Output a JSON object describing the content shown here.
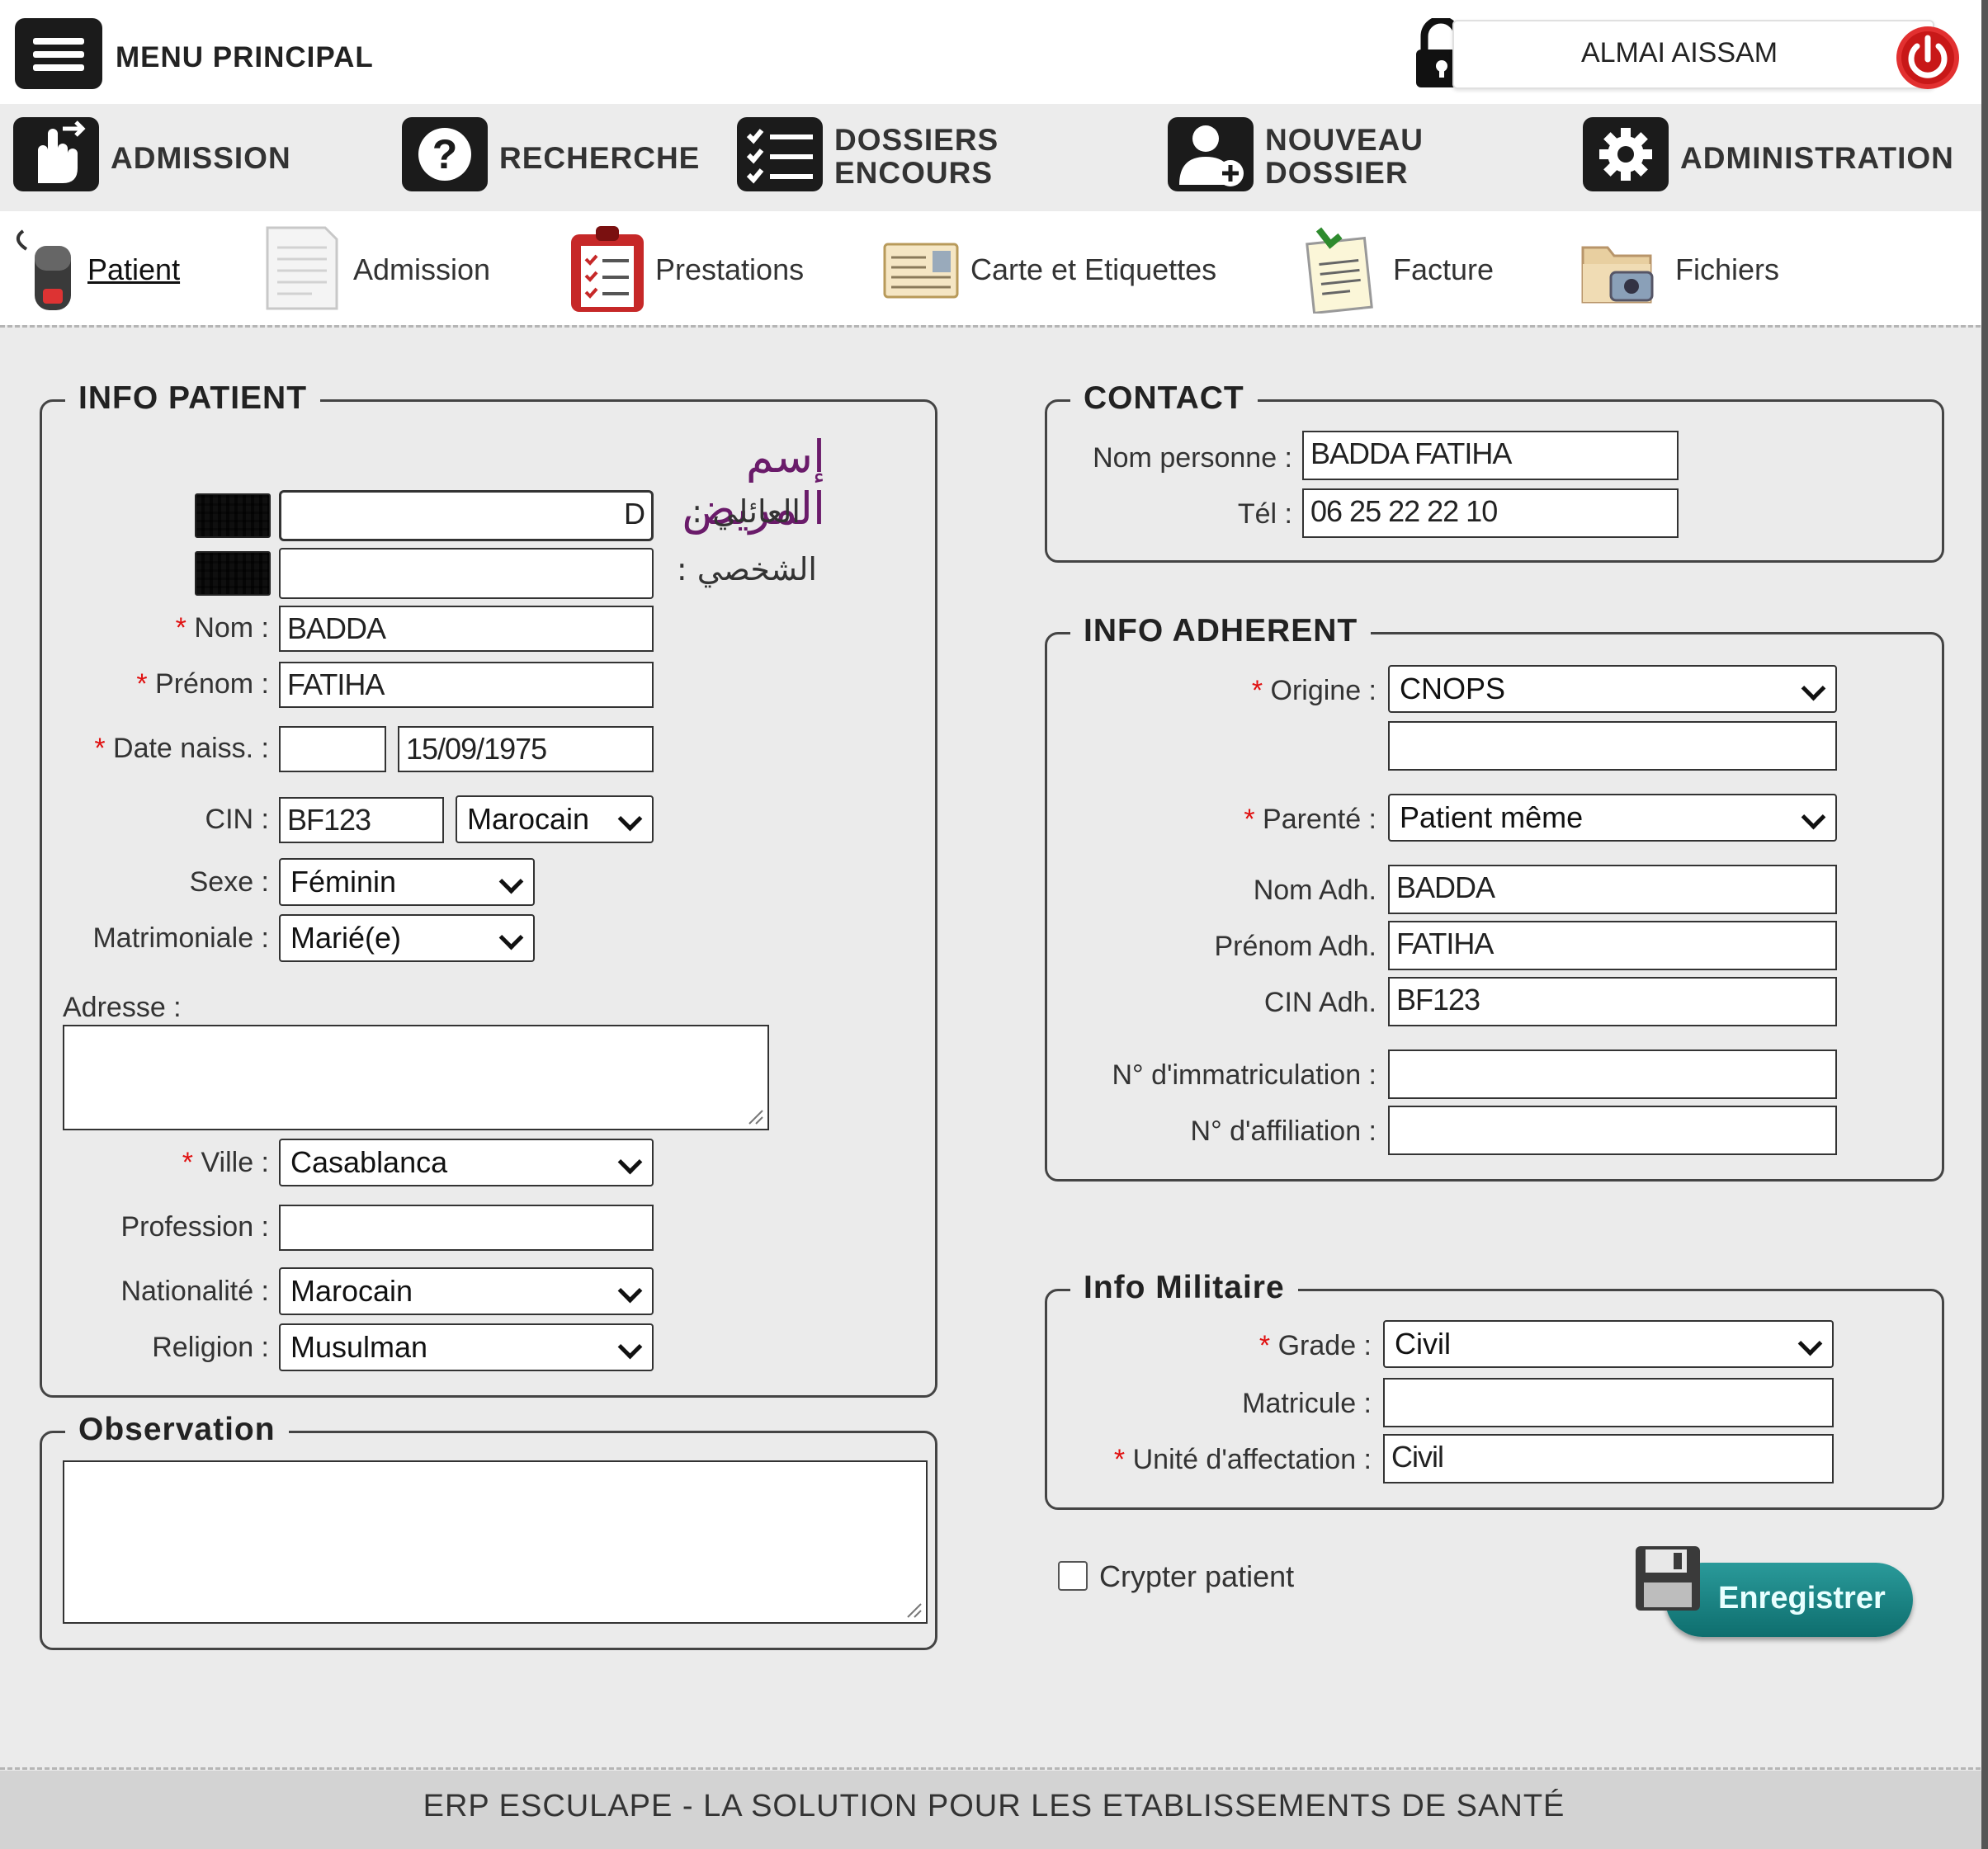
{
  "header": {
    "menu_label": "MENU PRINCIPAL",
    "username": "ALMAI AISSAM",
    "icons": [
      "menu-icon",
      "lock-icon",
      "power-icon"
    ]
  },
  "mainnav": [
    {
      "label_line1": "ADMISSION",
      "label_line2": "",
      "icon": "hand-pointer-icon"
    },
    {
      "label_line1": "RECHERCHE",
      "label_line2": "",
      "icon": "question-icon"
    },
    {
      "label_line1": "DOSSIERS",
      "label_line2": "ENCOURS",
      "icon": "checklist-icon"
    },
    {
      "label_line1": "NOUVEAU",
      "label_line2": "DOSSIER",
      "icon": "add-user-icon"
    },
    {
      "label_line1": "ADMINISTRATION",
      "label_line2": "",
      "icon": "gear-icon"
    }
  ],
  "subnav": [
    {
      "label": "Patient",
      "icon": "mouse-icon"
    },
    {
      "label": "Admission",
      "icon": "document-icon"
    },
    {
      "label": "Prestations",
      "icon": "clipboard-icon"
    },
    {
      "label": "Carte et Etiquettes",
      "icon": "id-card-icon"
    },
    {
      "label": "Facture",
      "icon": "invoice-icon"
    },
    {
      "label": "Fichiers",
      "icon": "folder-icon"
    }
  ],
  "info_patient": {
    "legend": "INFO PATIENT",
    "arabic_title": "إسم المريض",
    "arabic_family_label": "العائلي :",
    "arabic_family_value": "D",
    "arabic_personal_label": "الشخصي :",
    "arabic_personal_value": "",
    "nom_label": "Nom :",
    "nom_value": "BADDA",
    "prenom_label": "Prénom :",
    "prenom_value": "FATIHA",
    "datenaiss_label": "Date naiss. :",
    "age_value": "",
    "datenaiss_value": "15/09/1975",
    "cin_label": "CIN :",
    "cin_value": "BF123",
    "cin_nationality": "Marocain",
    "sexe_label": "Sexe :",
    "sexe_value": "Féminin",
    "matrimoniale_label": "Matrimoniale :",
    "matrimoniale_value": "Marié(e)",
    "adresse_label": "Adresse :",
    "adresse_value": "",
    "ville_label": "Ville :",
    "ville_value": "Casablanca",
    "profession_label": "Profession :",
    "profession_value": "",
    "nationalite_label": "Nationalité :",
    "nationalite_value": "Marocain",
    "religion_label": "Religion :",
    "religion_value": "Musulman"
  },
  "observation": {
    "legend": "Observation",
    "value": ""
  },
  "contact": {
    "legend": "CONTACT",
    "nom_personne_label": "Nom personne :",
    "nom_personne_value": "BADDA FATIHA",
    "tel_label": "Tél :",
    "tel_value": "06 25 22 22 10"
  },
  "info_adherent": {
    "legend": "INFO ADHERENT",
    "origine_label": "Origine :",
    "origine_value": "CNOPS",
    "origine_extra": "",
    "parente_label": "Parenté :",
    "parente_value": "Patient même",
    "nom_adh_label": "Nom Adh.",
    "nom_adh_value": "BADDA",
    "prenom_adh_label": "Prénom Adh.",
    "prenom_adh_value": "FATIHA",
    "cin_adh_label": "CIN Adh.",
    "cin_adh_value": "BF123",
    "immatriculation_label": "N° d'immatriculation :",
    "immatriculation_value": "",
    "affiliation_label": "N° d'affiliation :",
    "affiliation_value": ""
  },
  "info_militaire": {
    "legend": "Info Militaire",
    "grade_label": "Grade :",
    "grade_value": "Civil",
    "matricule_label": "Matricule :",
    "matricule_value": "",
    "unite_label": "Unité d'affectation :",
    "unite_value": "Civil"
  },
  "crypter_label": "Crypter patient",
  "save_label": "Enregistrer",
  "required_mark": "*",
  "footer": "ERP ESCULAPE - LA SOLUTION POUR LES ETABLISSEMENTS DE SANTÉ",
  "colors": {
    "accent": "#e01010",
    "save_button": "#0e6e6e",
    "arabic_title": "#6a1b6a"
  }
}
